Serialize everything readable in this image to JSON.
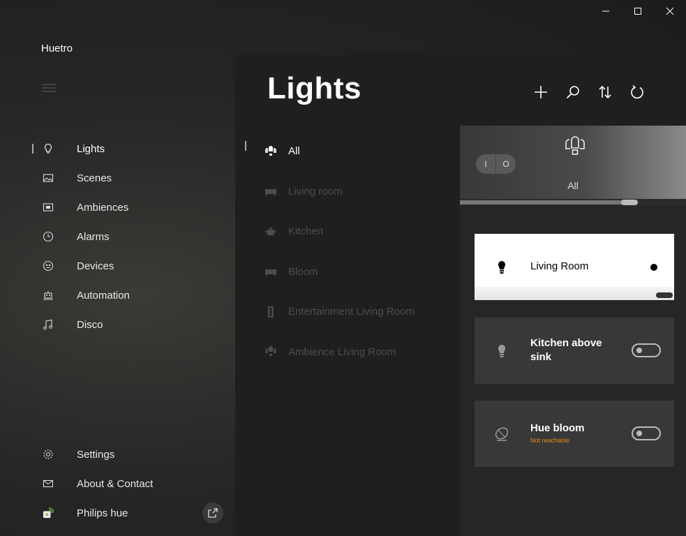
{
  "app": {
    "title": "Huetro"
  },
  "sidebar": {
    "items": [
      {
        "label": "Lights",
        "icon": "lightbulb-icon",
        "active": true
      },
      {
        "label": "Scenes",
        "icon": "image-icon"
      },
      {
        "label": "Ambiences",
        "icon": "video-icon"
      },
      {
        "label": "Alarms",
        "icon": "clock-icon"
      },
      {
        "label": "Devices",
        "icon": "devices-icon"
      },
      {
        "label": "Automation",
        "icon": "robot-icon"
      },
      {
        "label": "Disco",
        "icon": "music-icon"
      }
    ],
    "bottom": [
      {
        "label": "Settings",
        "icon": "gear-icon"
      },
      {
        "label": "About & Contact",
        "icon": "mail-icon"
      },
      {
        "label": "Philips hue",
        "icon": "bridge-icon"
      }
    ]
  },
  "main": {
    "title": "Lights",
    "toolbar": [
      "add-icon",
      "search-icon",
      "sort-icon",
      "refresh-icon"
    ]
  },
  "rooms": [
    {
      "label": "All",
      "icon": "group-bulbs-icon",
      "active": true
    },
    {
      "label": "Living room",
      "icon": "sofa-icon"
    },
    {
      "label": "Kitchen",
      "icon": "pot-icon"
    },
    {
      "label": "Bloom",
      "icon": "sofa-icon"
    },
    {
      "label": "Entertainment Living Room",
      "icon": "speaker-icon"
    },
    {
      "label": "Ambience Living Room",
      "icon": "group-bulbs-icon"
    }
  ],
  "panel": {
    "group_label": "All",
    "on_label": "I",
    "off_label": "O",
    "brightness": 0.77,
    "lights": [
      {
        "name": "Living Room",
        "on": true,
        "status": "",
        "brightness": 1.0
      },
      {
        "name": "Kitchen above sink",
        "on": false,
        "status": ""
      },
      {
        "name": "Hue bloom",
        "on": false,
        "status": "Not reachable"
      }
    ]
  },
  "colors": {
    "status_warning": "#e28a1a",
    "accent": "#ffffff"
  }
}
